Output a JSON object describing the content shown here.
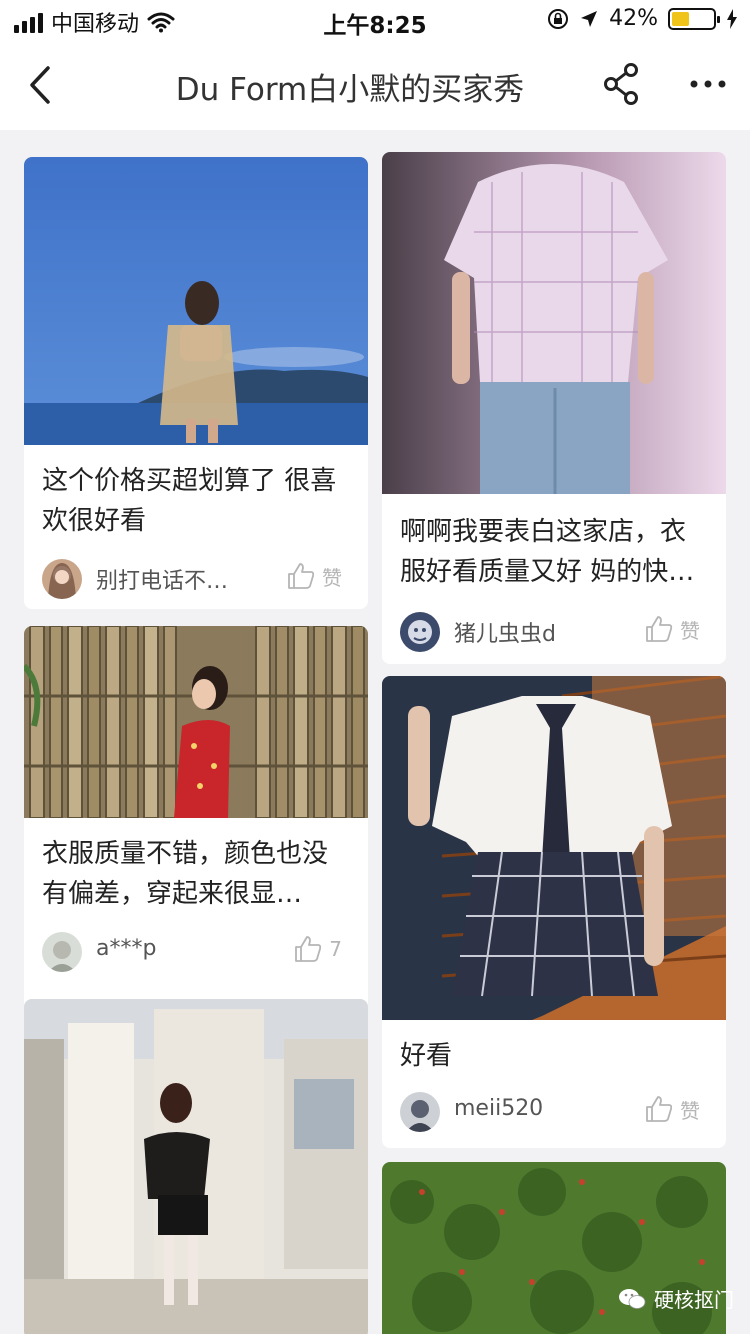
{
  "status_bar": {
    "carrier": "中国移动",
    "time": "上午8:25",
    "battery_percent": "42%",
    "battery_level": 0.42,
    "battery_color": "#f0c419"
  },
  "nav": {
    "back_icon": "chevron-left-icon",
    "title": "Du Form白小默的买家秀",
    "share_icon": "share-icon",
    "more_icon": "more-dots-icon"
  },
  "posts": [
    {
      "caption": "这个价格买超划算了 很喜欢很好看",
      "user": "别打电话不…",
      "likes": "赞"
    },
    {
      "caption": "啊啊我要表白这家店，衣服好看质量又好 妈的快…",
      "user": "猪儿虫虫d",
      "likes": "赞"
    },
    {
      "caption": "衣服质量不错，颜色也没有偏差，穿起来很显白，…",
      "user": "a***p",
      "likes": "7"
    },
    {
      "caption": "好看",
      "user": "meii520",
      "likes": "赞"
    },
    {
      "caption": "",
      "user": "",
      "likes": ""
    },
    {
      "caption": "",
      "user": "",
      "likes": ""
    }
  ],
  "watermark": {
    "text": "硬核抠门",
    "icon": "wechat-icon"
  }
}
